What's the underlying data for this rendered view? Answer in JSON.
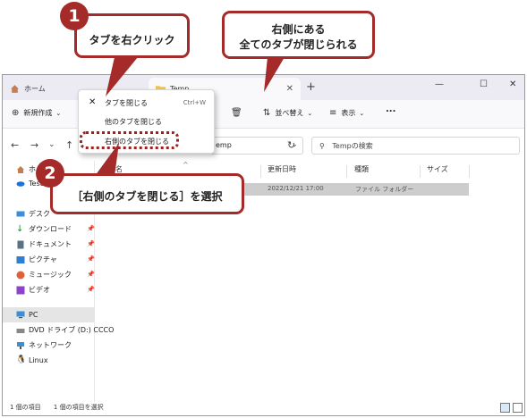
{
  "tabs": {
    "home": "ホーム",
    "temp": "Temp"
  },
  "toolbar": {
    "new": "新規作成",
    "sort": "並べ替え",
    "view": "表示",
    "more": "..."
  },
  "address": {
    "path": "emp",
    "search_placeholder": "Tempの検索"
  },
  "sidebar": {
    "items": [
      {
        "label": "ホ"
      },
      {
        "label": "Test"
      },
      {
        "label": "デスク"
      },
      {
        "label": "ダウンロード"
      },
      {
        "label": "ドキュメント"
      },
      {
        "label": "ピクチャ"
      },
      {
        "label": "ミュージック"
      },
      {
        "label": "ビデオ"
      },
      {
        "label": "PC"
      },
      {
        "label": "DVD ドライブ (D:) CCCO"
      },
      {
        "label": "ネットワーク"
      },
      {
        "label": "Linux"
      }
    ]
  },
  "columns": {
    "name": "名",
    "modified": "更新日時",
    "type": "種類",
    "size": "サイズ"
  },
  "row": {
    "date": "2022/12/21 17:00",
    "type": "ファイル フォルダー"
  },
  "context_menu": {
    "close": "タブを閉じる",
    "close_shortcut": "Ctrl+W",
    "close_others": "他のタブを閉じる",
    "close_right": "右側のタブを閉じる"
  },
  "status": {
    "count": "1 個の項目",
    "selected": "1 個の項目を選択"
  },
  "callouts": {
    "c1_num": "1",
    "c1_text": "タブを右クリック",
    "c2_num": "2",
    "c2_text": "［右側のタブを閉じる］を選択",
    "c3_line1": "右側にある",
    "c3_line2": "全てのタブが閉じられる"
  },
  "colors": {
    "accent": "#a52a2a",
    "selection": "#cdcdcd"
  }
}
